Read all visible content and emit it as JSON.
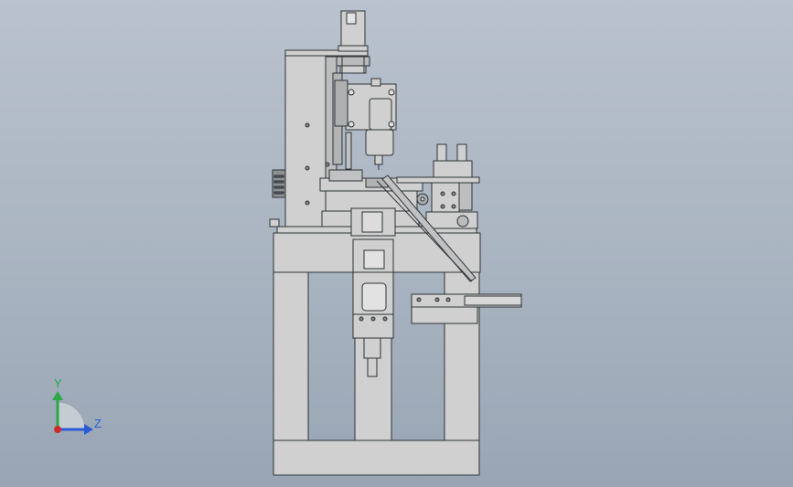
{
  "viewport": {
    "background_top": "#b9c2cd",
    "background_bottom": "#98a5b4"
  },
  "model": {
    "part_fill": "#cfd0cf",
    "part_stroke": "#2f3337",
    "shadow_fill": "#9ea3a6",
    "accent_blue": "#2a4f6b"
  },
  "triad": {
    "y_label": "Y",
    "z_label": "Z",
    "y_color": "#2aa84a",
    "z_color": "#2a5bd6",
    "x_color": "#d02a2a"
  }
}
